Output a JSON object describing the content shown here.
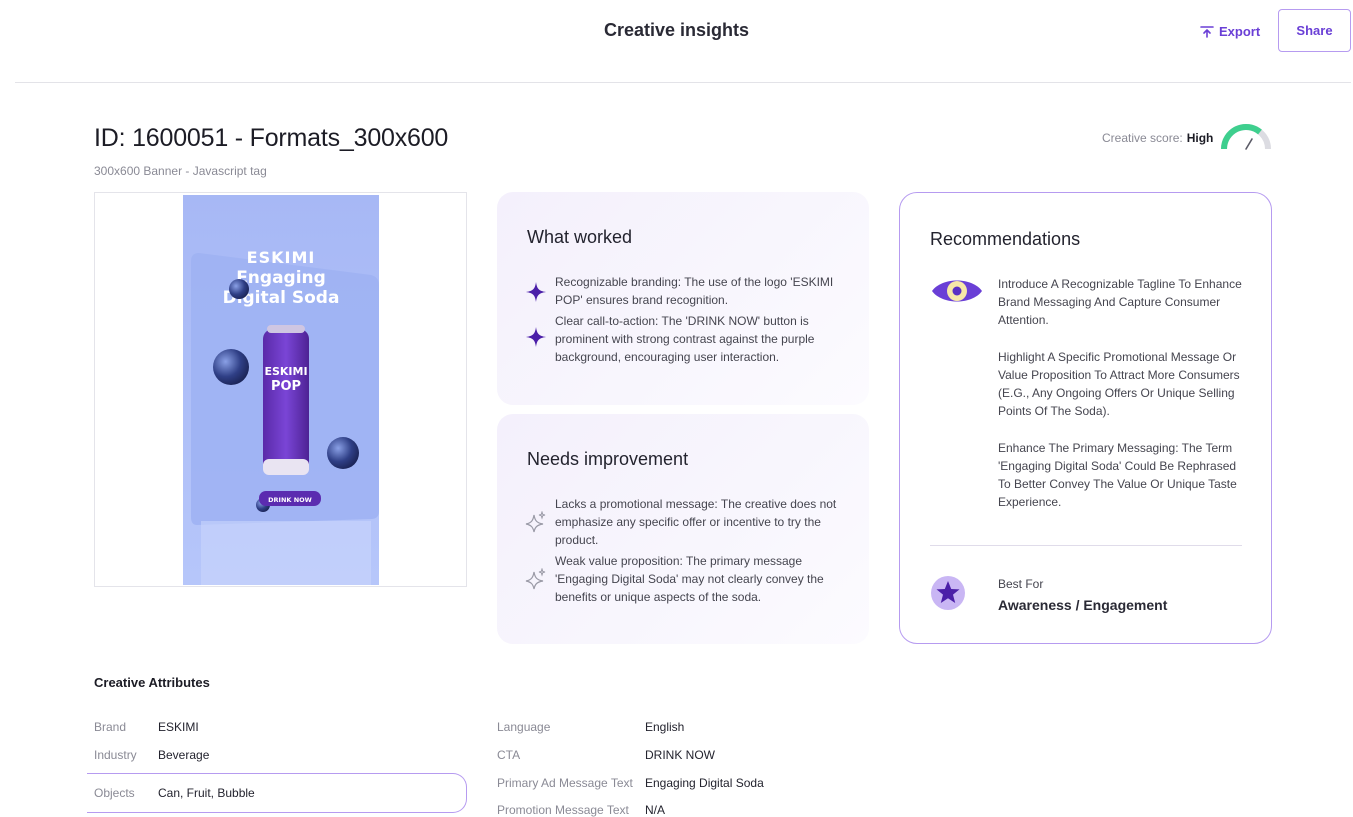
{
  "header": {
    "title": "Creative insights",
    "export_label": "Export",
    "share_label": "Share"
  },
  "creative": {
    "id_title": "ID: 1600051 - Formats_300x600",
    "subtitle": "300x600 Banner - Javascript tag",
    "score_label": "Creative score:",
    "score_value": "High",
    "preview": {
      "brand_text": "ESKIMI",
      "headline_1": "Engaging",
      "headline_2": "Digital Soda",
      "can_text_1": "ESKIMI",
      "can_text_2": "POP",
      "button_text": "DRINK NOW"
    }
  },
  "what_worked": {
    "title": "What worked",
    "items": [
      "Recognizable branding: The use of the logo 'ESKIMI POP' ensures brand recognition.",
      "Clear call-to-action: The 'DRINK NOW' button is prominent with strong contrast against the purple background, encouraging user interaction."
    ]
  },
  "needs_improvement": {
    "title": "Needs improvement",
    "items": [
      "Lacks a promotional message: The creative does not emphasize any specific offer or incentive to try the product.",
      "Weak value proposition: The primary message 'Engaging Digital Soda' may not clearly convey the benefits or unique aspects of the soda."
    ]
  },
  "recommendations": {
    "title": "Recommendations",
    "items": [
      "Introduce A Recognizable Tagline To Enhance Brand Messaging And Capture Consumer Attention.",
      "Highlight A Specific Promotional Message Or Value Proposition To Attract More Consumers (E.G., Any Ongoing Offers Or Unique Selling Points Of The Soda).",
      "Enhance The Primary Messaging: The Term 'Engaging Digital Soda' Could Be Rephrased To Better Convey The Value Or Unique Taste Experience."
    ],
    "best_for_label": "Best For",
    "best_for_value": "Awareness / Engagement"
  },
  "attributes": {
    "title": "Creative Attributes",
    "left": [
      {
        "key": "Brand",
        "value": "ESKIMI"
      },
      {
        "key": "Industry",
        "value": "Beverage"
      },
      {
        "key": "Objects",
        "value": "Can, Fruit, Bubble"
      }
    ],
    "right": [
      {
        "key": "Language",
        "value": "English"
      },
      {
        "key": "CTA",
        "value": "DRINK NOW"
      },
      {
        "key": "Primary Ad Message Text",
        "value": "Engaging Digital Soda"
      },
      {
        "key": "Promotion Message Text",
        "value": "N/A"
      }
    ]
  },
  "colors": {
    "accent": "#6a3fd6",
    "accent_border": "#b69bf0",
    "gauge_green": "#3ecf8e",
    "card_bg": "#f4f0fc",
    "preview_bg": "#a9bdf7"
  },
  "icons": {
    "export": "upload-arrow-icon",
    "worked_bullet": "sparkle-filled-icon",
    "needs_bullet": "sparkle-outline-icon",
    "reco": "eye-icon",
    "best_for": "star-badge-icon",
    "score": "gauge-icon"
  }
}
